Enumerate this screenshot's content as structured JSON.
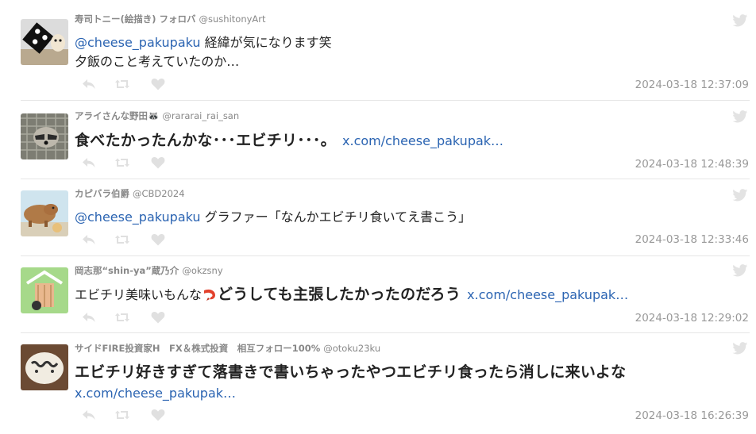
{
  "tweets": [
    {
      "display_name": "寿司トニー(絵描き) フォロバ",
      "handle": "@sushitonyArt",
      "line1_mention": "@cheese_pakupaku",
      "line1_text": " 経緯が気になります笑",
      "line2_text": "夕飯のこと考えていたのか…",
      "timestamp": "2024-03-18 12:37:09"
    },
    {
      "display_name": "アライさんな野田🦝",
      "handle": "@rararai_rai_san",
      "text_bold": "食べたかったんかな･･･エビチリ･･･。",
      "link": "x.com/cheese_pakupak…",
      "timestamp": "2024-03-18 12:48:39"
    },
    {
      "display_name": "カピバラ伯爵",
      "handle": "@CBD2024",
      "mention": "@cheese_pakupaku",
      "text": " グラファー「なんかエビチリ食いてえ書こう」",
      "timestamp": "2024-03-18 12:33:46"
    },
    {
      "display_name": "岡志那“shin-ya”蔵乃介",
      "handle": "@okzsny",
      "text_plain": "エビチリ美味いもんな",
      "emoji": "shrimp-icon",
      "text_bold": "どうしても主張したかったのだろう",
      "link": "x.com/cheese_pakupak…",
      "timestamp": "2024-03-18 12:29:02"
    },
    {
      "display_name": "サイドFIRE投資家H　FX＆株式投資　相互フォロー100%",
      "handle": "@otoku23ku",
      "text_bold": "エビチリ好きすぎて落書きで書いちゃったやつエビチリ食ったら消しに来いよな",
      "link": "x.com/cheese_pakupak…",
      "timestamp": "2024-03-18 16:26:39"
    }
  ],
  "icons": {
    "reply": "reply-icon",
    "retweet": "retweet-icon",
    "like": "heart-icon",
    "platform": "twitter-bird-icon"
  },
  "colors": {
    "link": "#2b64b2",
    "meta": "#999999",
    "icon": "#dddddd"
  }
}
